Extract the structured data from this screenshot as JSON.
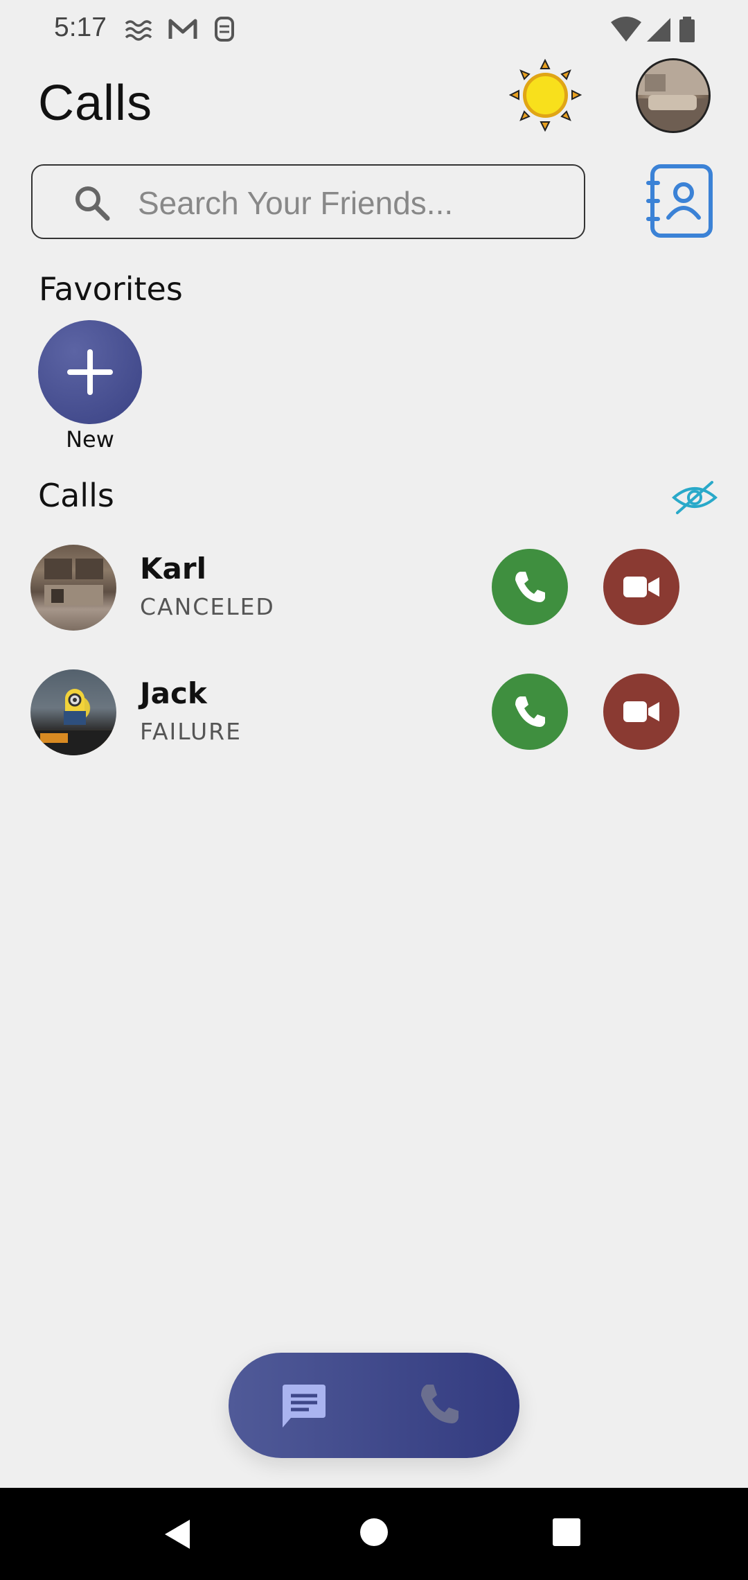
{
  "status_bar": {
    "time": "5:17"
  },
  "header": {
    "title": "Calls",
    "theme_icon": "sun-icon",
    "avatar_icon": "profile-avatar"
  },
  "search": {
    "placeholder": "Search Your Friends..."
  },
  "favorites": {
    "title": "Favorites",
    "new_label": "New"
  },
  "calls_section": {
    "title": "Calls",
    "toggle_icon": "eye-off-icon"
  },
  "calls": [
    {
      "name": "Karl",
      "status": "CANCELED"
    },
    {
      "name": "Jack",
      "status": "FAILURE"
    }
  ],
  "bottom_nav": {
    "items": [
      "chat-icon",
      "phone-icon"
    ],
    "active": "chat-icon"
  },
  "colors": {
    "background": "#efefef",
    "accent": "#3e4789",
    "call_green": "#3f8f3f",
    "video_red": "#8a3a32",
    "contacts_blue": "#3b82d6",
    "eye_cyan": "#29a9c9"
  }
}
